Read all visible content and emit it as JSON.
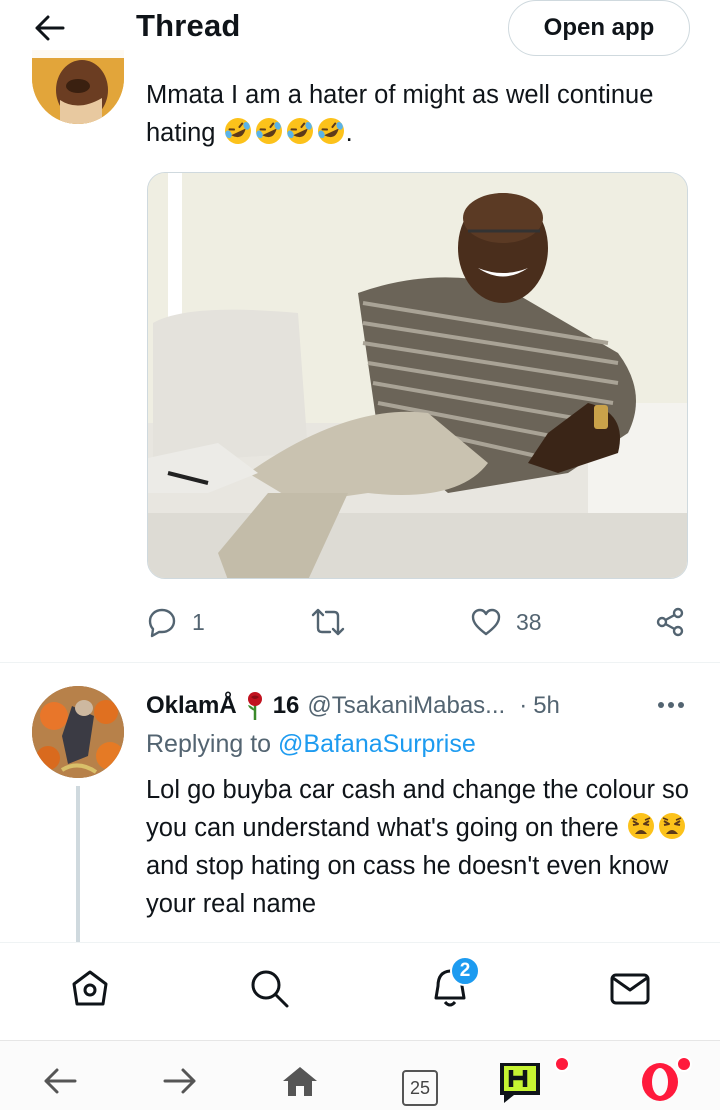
{
  "header": {
    "title": "Thread",
    "open_app_label": "Open app"
  },
  "tweet1": {
    "text": "Mmata I am a hater of might as well continue hating",
    "emoji": [
      "rolling-on-floor-laughing",
      "rolling-on-floor-laughing",
      "rolling-on-floor-laughing",
      "rolling-on-floor-laughing"
    ],
    "trailing": ".",
    "replies": "1",
    "likes": "38"
  },
  "tweet2": {
    "name": "OklamÅ",
    "name_suffix": "16",
    "handle": "@TsakaniMabas...",
    "separator": "·",
    "time": "5h",
    "replying_prefix": "Replying to",
    "replying_to": "@BafanaSurprise",
    "text_part1": "Lol go buyba car cash and change the colour so you can understand what's going on there",
    "text_part2": "and stop hating on cass he doesn't even know your real name",
    "emoji": [
      "weary-face",
      "weary-face"
    ]
  },
  "twitter_nav": {
    "notifications_badge": "2",
    "items": [
      "home-icon",
      "search-icon",
      "notifications-icon",
      "messages-icon"
    ]
  },
  "browser_bar": {
    "tabs_count": "25",
    "items": [
      "back-icon",
      "forward-icon",
      "home-icon",
      "tabs-icon",
      "hype-app-icon",
      "opera-icon"
    ],
    "accent": "#ff1a3c"
  },
  "colors": {
    "link": "#1d9bf0",
    "secondary_text": "#536471",
    "primary_text": "#0f1419"
  }
}
